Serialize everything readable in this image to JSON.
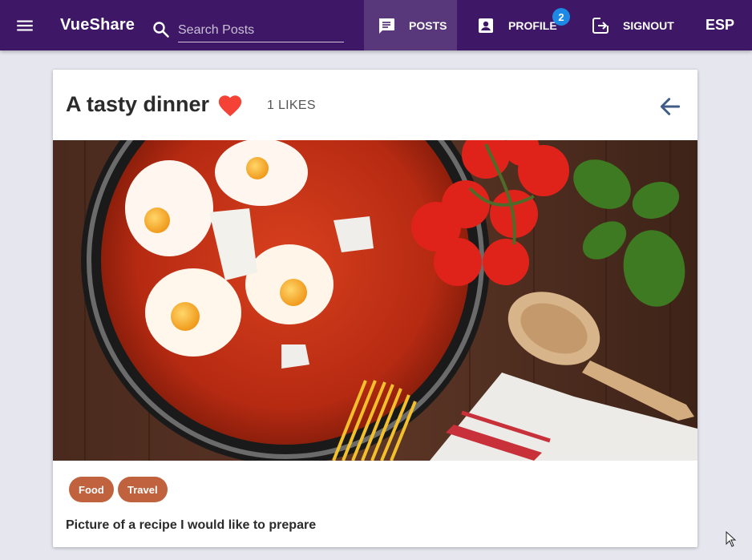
{
  "app": {
    "brand": "VueShare"
  },
  "search": {
    "placeholder": "Search Posts"
  },
  "nav": {
    "posts_label": "POSTS",
    "profile_label": "PROFILE",
    "profile_badge": "2",
    "signout_label": "SIGNOUT",
    "language_label": "ESP"
  },
  "post": {
    "title": "A tasty dinner",
    "likes_label": "1 LIKES",
    "image_icon": "food-photo",
    "tags": [
      "Food",
      "Travel"
    ],
    "description": "Picture of a recipe I would like to prepare"
  },
  "icons": {
    "menu": "hamburger-menu-icon",
    "search": "search-icon",
    "posts": "chat-icon",
    "profile": "account-box-icon",
    "signout": "exit-icon",
    "like": "heart-icon",
    "back": "arrow-left-icon"
  },
  "colors": {
    "toolbar": "#3e1766",
    "accent": "#c0623e",
    "badge": "#1e88e5",
    "heart": "#f44336",
    "back_arrow": "#3f5d86",
    "background": "#e6e6ef"
  }
}
